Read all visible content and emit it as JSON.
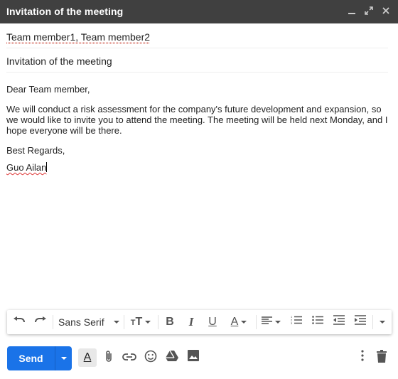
{
  "window": {
    "title": "Invitation of the meeting",
    "controls": {
      "minimize_icon": "minimize-icon",
      "expand_icon": "expand-icon",
      "close_icon": "close-icon"
    }
  },
  "compose": {
    "to": "Team member1, Team member2",
    "subject": "Invitation of the meeting",
    "body": {
      "greeting": "Dear Team member,",
      "paragraph": "We will conduct a risk assessment for the company's future development and expansion, so we would like to invite you to attend the meeting. The meeting will be held next Monday, and I hope everyone will be there.",
      "closing": "Best Regards,",
      "signature": "Guo Ailan"
    }
  },
  "formatting_toolbar": {
    "font": "Sans Serif",
    "tools": [
      "undo",
      "redo",
      "font-family",
      "font-size",
      "bold",
      "italic",
      "underline",
      "text-color",
      "align",
      "numbered-list",
      "bulleted-list",
      "indent-less",
      "indent-more",
      "more-formatting"
    ],
    "glyphs": {
      "bold": "B",
      "italic": "I",
      "underline": "U",
      "text_color": "A"
    }
  },
  "bottom_bar": {
    "send_label": "Send",
    "formatting_toggle_glyph": "A",
    "colors": {
      "send": "#1a73e8",
      "titlebar": "#404040"
    }
  }
}
